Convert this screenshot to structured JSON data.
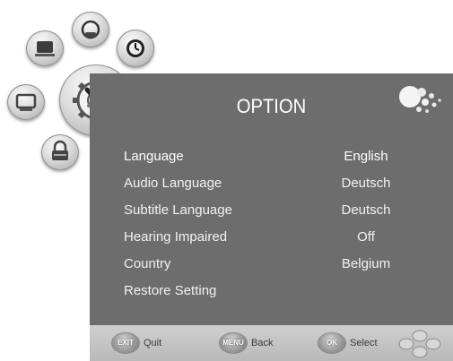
{
  "title": "OPTION",
  "menu": {
    "items": [
      {
        "label": "Language",
        "value": "English"
      },
      {
        "label": "Audio Language",
        "value": "Deutsch"
      },
      {
        "label": "Subtitle Language",
        "value": "Deutsch"
      },
      {
        "label": "Hearing Impaired",
        "value": "Off"
      },
      {
        "label": "Country",
        "value": "Belgium"
      },
      {
        "label": "Restore Setting",
        "value": ""
      }
    ]
  },
  "footer": {
    "exit_key": "EXIT",
    "exit_label": "Quit",
    "menu_key": "MENU",
    "menu_label": "Back",
    "ok_key": "OK",
    "ok_label": "Select"
  },
  "icons": [
    "picture-icon",
    "sound-icon",
    "clock-icon",
    "channel-icon",
    "option-gear-icon",
    "lock-icon"
  ],
  "colors": {
    "panel": "#6d6d6d",
    "footer": "#c4c4c4",
    "text": "#ffffff"
  }
}
